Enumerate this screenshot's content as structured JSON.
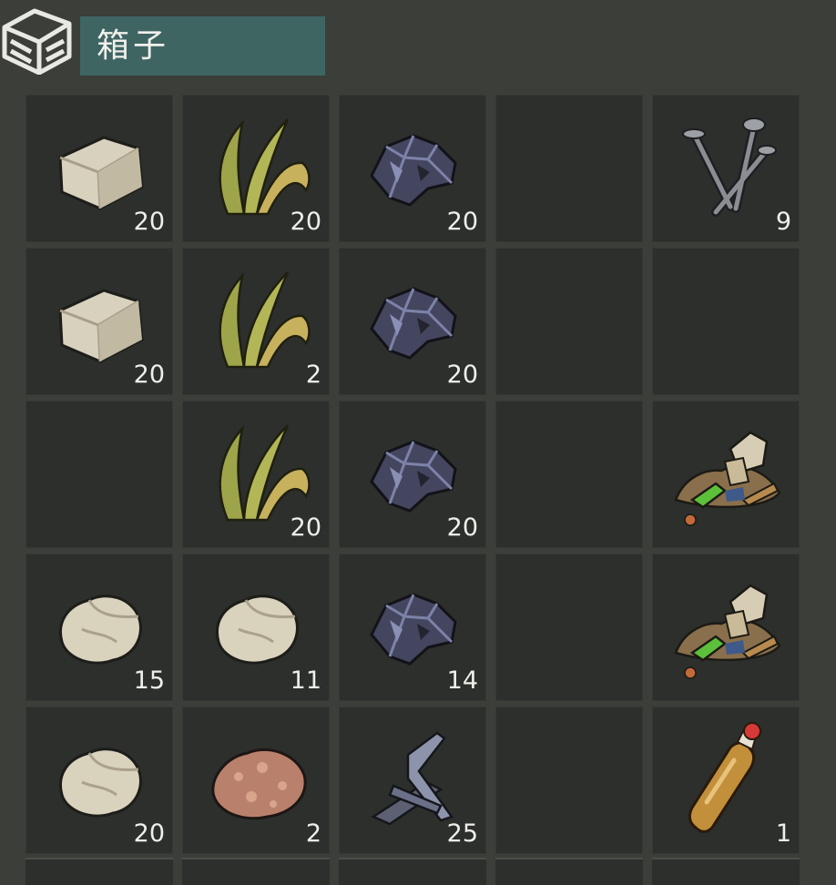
{
  "container": {
    "title": "箱子"
  },
  "slots": [
    {
      "item": "stone-block",
      "qty": "20"
    },
    {
      "item": "plant-fiber",
      "qty": "20"
    },
    {
      "item": "metal-ore",
      "qty": "20"
    },
    {
      "item": "",
      "qty": ""
    },
    {
      "item": "nails",
      "qty": "9"
    },
    {
      "item": "stone-block",
      "qty": "20"
    },
    {
      "item": "plant-fiber",
      "qty": "2"
    },
    {
      "item": "metal-ore",
      "qty": "20"
    },
    {
      "item": "",
      "qty": ""
    },
    {
      "item": "",
      "qty": ""
    },
    {
      "item": "",
      "qty": ""
    },
    {
      "item": "plant-fiber",
      "qty": "20"
    },
    {
      "item": "metal-ore",
      "qty": "20"
    },
    {
      "item": "",
      "qty": ""
    },
    {
      "item": "junk-pile",
      "qty": ""
    },
    {
      "item": "stone",
      "qty": "15"
    },
    {
      "item": "stone",
      "qty": "11"
    },
    {
      "item": "metal-ore",
      "qty": "14"
    },
    {
      "item": "",
      "qty": ""
    },
    {
      "item": "junk-pile",
      "qty": ""
    },
    {
      "item": "stone",
      "qty": "20"
    },
    {
      "item": "copper-ore",
      "qty": "2"
    },
    {
      "item": "scrap-metal",
      "qty": "25"
    },
    {
      "item": "",
      "qty": ""
    },
    {
      "item": "plastic-bottle",
      "qty": "1"
    }
  ]
}
